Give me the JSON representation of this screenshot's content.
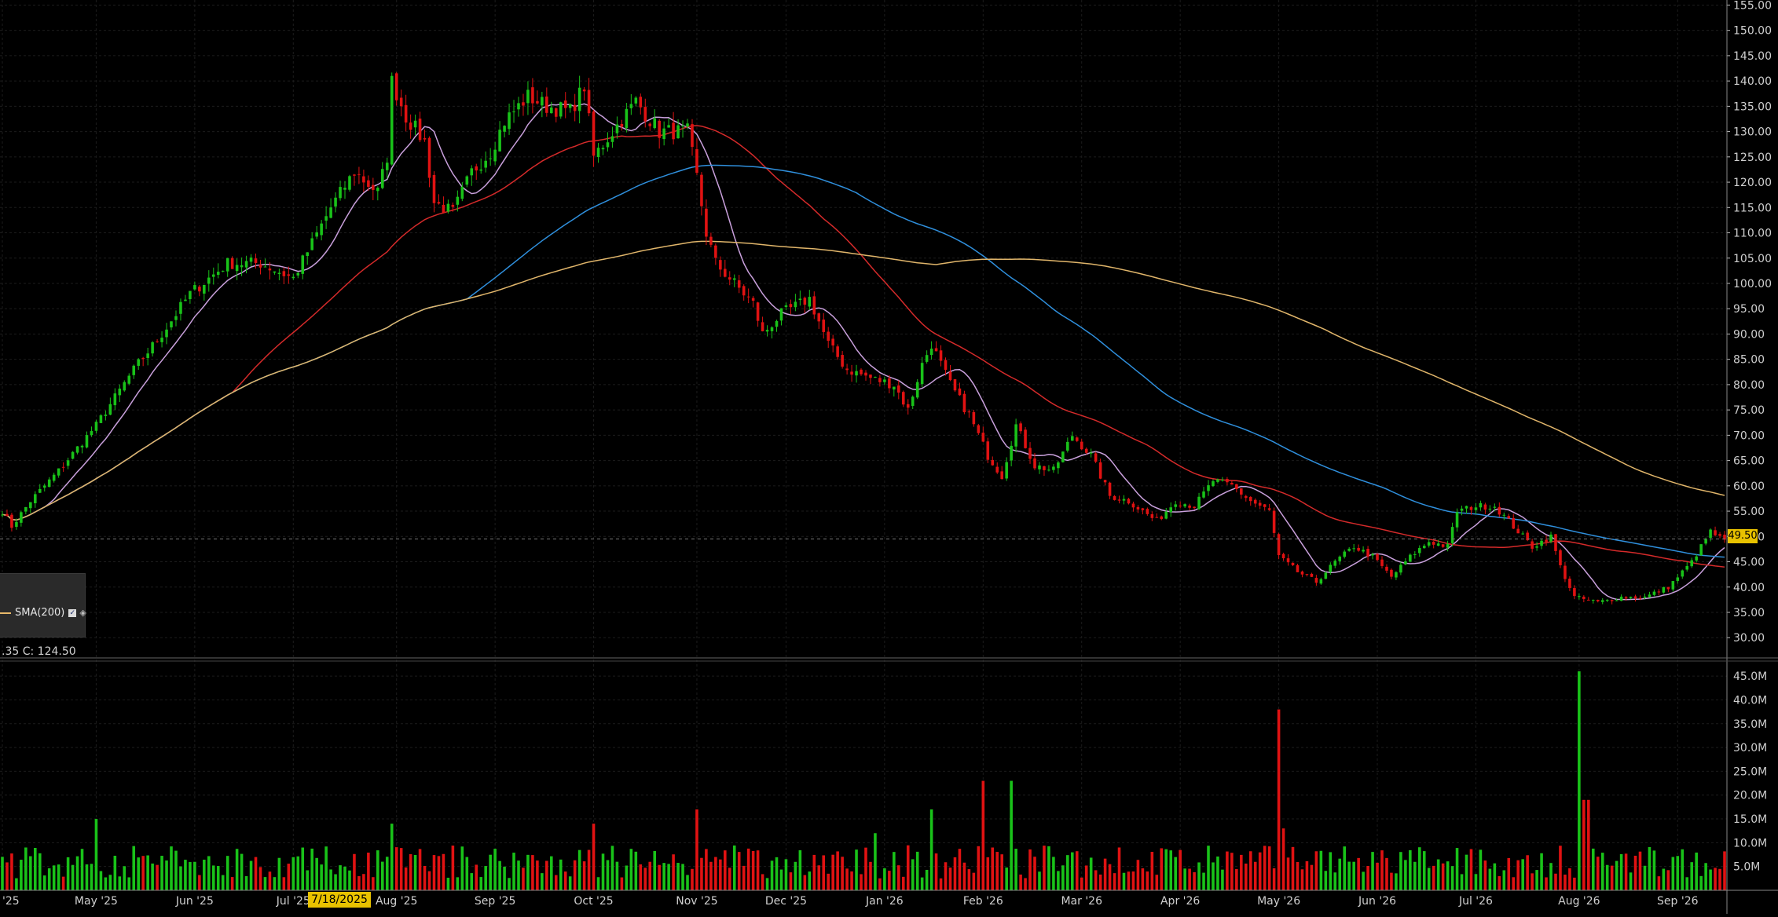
{
  "legend": {
    "sma_label": "SMA(200)",
    "check_mark": "✓",
    "eye_icon": "eye-icon"
  },
  "ohlc_readout": ".35  C: 124.50",
  "last_price_label": "49.50",
  "crosshair_date_label": "7/18/2025",
  "colors": {
    "background": "#000000",
    "up": "#19c219",
    "down": "#e01212",
    "sma10": "#c9a0dc",
    "sma50": "#d42a2a",
    "sma100": "#2f8fdc",
    "sma200": "#e0b56a",
    "grid": "#1c1c1c",
    "badge": "#e8c200"
  },
  "chart_data": [
    {
      "type": "candlestick",
      "panel": "price",
      "x_tick_labels": [
        "'25",
        "May '25",
        "Jun '25",
        "Jul '25",
        "Aug '25",
        "Sep '25",
        "Oct '25",
        "Nov '25",
        "Dec '25",
        "Jan '26",
        "Feb '26",
        "Mar '26",
        "Apr '26",
        "May '26",
        "Jun '26",
        "Jul '26",
        "Aug '26",
        "Sep '26"
      ],
      "x_tick_values": [
        0,
        20,
        41,
        62,
        84,
        105,
        126,
        148,
        167,
        188,
        209,
        230,
        251,
        272,
        293,
        314,
        336,
        357
      ],
      "y_tick_labels": [
        "30.00",
        "35.00",
        "40.00",
        "45.00",
        "50.00",
        "55.00",
        "60.00",
        "65.00",
        "70.00",
        "75.00",
        "80.00",
        "85.00",
        "90.00",
        "95.00",
        "100.00",
        "105.00",
        "110.00",
        "115.00",
        "120.00",
        "125.00",
        "130.00",
        "135.00",
        "140.00",
        "145.00",
        "150.00",
        "155.00"
      ],
      "ylim": [
        26,
        156
      ],
      "last_price": 49.5,
      "anchors": [
        [
          0,
          55
        ],
        [
          2,
          52
        ],
        [
          6,
          57
        ],
        [
          12,
          63
        ],
        [
          20,
          72
        ],
        [
          28,
          83
        ],
        [
          34,
          90
        ],
        [
          40,
          98
        ],
        [
          48,
          104
        ],
        [
          55,
          104
        ],
        [
          62,
          101
        ],
        [
          70,
          115
        ],
        [
          75,
          122
        ],
        [
          80,
          118
        ],
        [
          82,
          125
        ],
        [
          83,
          140
        ],
        [
          86,
          133
        ],
        [
          90,
          128
        ],
        [
          92,
          116
        ],
        [
          96,
          114
        ],
        [
          100,
          122
        ],
        [
          104,
          126
        ],
        [
          107,
          132
        ],
        [
          112,
          137
        ],
        [
          116,
          135
        ],
        [
          121,
          134
        ],
        [
          124,
          139
        ],
        [
          126,
          125
        ],
        [
          130,
          130
        ],
        [
          135,
          136
        ],
        [
          140,
          130
        ],
        [
          146,
          130
        ],
        [
          148,
          121
        ],
        [
          150,
          110
        ],
        [
          152,
          104
        ],
        [
          156,
          100
        ],
        [
          160,
          96
        ],
        [
          162,
          90
        ],
        [
          166,
          94
        ],
        [
          172,
          97
        ],
        [
          176,
          88
        ],
        [
          180,
          83
        ],
        [
          186,
          81
        ],
        [
          190,
          80
        ],
        [
          193,
          75
        ],
        [
          196,
          84
        ],
        [
          198,
          88
        ],
        [
          202,
          80
        ],
        [
          206,
          74
        ],
        [
          210,
          66
        ],
        [
          213,
          62
        ],
        [
          216,
          72
        ],
        [
          220,
          64
        ],
        [
          224,
          63
        ],
        [
          228,
          70
        ],
        [
          232,
          66
        ],
        [
          236,
          58
        ],
        [
          240,
          57
        ],
        [
          246,
          53
        ],
        [
          250,
          57
        ],
        [
          254,
          56
        ],
        [
          258,
          61
        ],
        [
          262,
          60
        ],
        [
          266,
          57
        ],
        [
          270,
          55
        ],
        [
          272,
          46
        ],
        [
          276,
          43
        ],
        [
          280,
          41
        ],
        [
          284,
          45
        ],
        [
          288,
          48
        ],
        [
          292,
          46
        ],
        [
          296,
          42
        ],
        [
          300,
          46
        ],
        [
          304,
          49
        ],
        [
          308,
          48
        ],
        [
          310,
          55
        ],
        [
          314,
          56
        ],
        [
          318,
          56
        ],
        [
          322,
          52
        ],
        [
          326,
          48
        ],
        [
          330,
          50
        ],
        [
          332,
          44
        ],
        [
          335,
          38
        ],
        [
          340,
          37
        ],
        [
          345,
          38
        ],
        [
          350,
          38
        ],
        [
          355,
          40
        ],
        [
          360,
          45
        ],
        [
          364,
          51
        ],
        [
          367,
          49
        ]
      ],
      "sma_series": [
        {
          "period": 10,
          "color": "#c9a0dc"
        },
        {
          "period": 50,
          "color": "#d42a2a"
        },
        {
          "period": 100,
          "color": "#2f8fdc"
        },
        {
          "period": 200,
          "color": "#e0b56a"
        }
      ]
    },
    {
      "type": "bar",
      "panel": "volume",
      "y_tick_labels": [
        "5.0M",
        "10.0M",
        "15.0M",
        "20.0M",
        "25.0M",
        "30.0M",
        "35.0M",
        "40.0M",
        "45.0M"
      ],
      "ylim": [
        0,
        47.5
      ],
      "spikes": [
        [
          20,
          15
        ],
        [
          83,
          14
        ],
        [
          126,
          14
        ],
        [
          148,
          17
        ],
        [
          186,
          12
        ],
        [
          198,
          17
        ],
        [
          209,
          23
        ],
        [
          215,
          23
        ],
        [
          272,
          38
        ],
        [
          273,
          13
        ],
        [
          336,
          46
        ],
        [
          337,
          19
        ],
        [
          338,
          19
        ]
      ]
    }
  ]
}
